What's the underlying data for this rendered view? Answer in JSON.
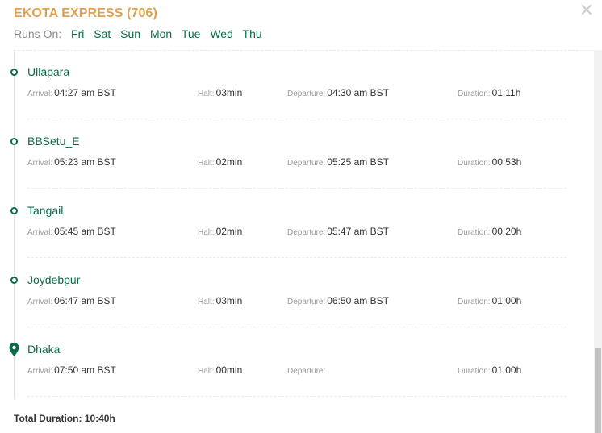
{
  "train": {
    "title": "EKOTA EXPRESS (706)"
  },
  "runs_on": {
    "label": "Runs On:",
    "days": [
      "Fri",
      "Sat",
      "Sun",
      "Mon",
      "Tue",
      "Wed",
      "Thu"
    ]
  },
  "labels": {
    "arrival": "Arrival:",
    "halt": "Halt:",
    "departure": "Departure:",
    "duration": "Duration:"
  },
  "stations": [
    {
      "name": "Ullapara",
      "arrival": "04:27 am BST",
      "halt": "03min",
      "departure": "04:30 am BST",
      "duration": "01:11h",
      "icon": "circle-dot"
    },
    {
      "name": "BBSetu_E",
      "arrival": "05:23 am BST",
      "halt": "02min",
      "departure": "05:25 am BST",
      "duration": "00:53h",
      "icon": "circle-dot"
    },
    {
      "name": "Tangail",
      "arrival": "05:45 am BST",
      "halt": "02min",
      "departure": "05:47 am BST",
      "duration": "00:20h",
      "icon": "circle-dot"
    },
    {
      "name": "Joydebpur",
      "arrival": "06:47 am BST",
      "halt": "03min",
      "departure": "06:50 am BST",
      "duration": "01:00h",
      "icon": "circle-dot"
    },
    {
      "name": "Dhaka",
      "arrival": "07:50 am BST",
      "halt": "00min",
      "departure": "",
      "duration": "01:00h",
      "icon": "map-pin"
    }
  ],
  "total": {
    "text": "Total Duration: 10:40h"
  },
  "colors": {
    "title": "#e0a050",
    "accent": "#0a6b4b",
    "muted": "#9a9a9a"
  },
  "close_icon": "close-icon"
}
